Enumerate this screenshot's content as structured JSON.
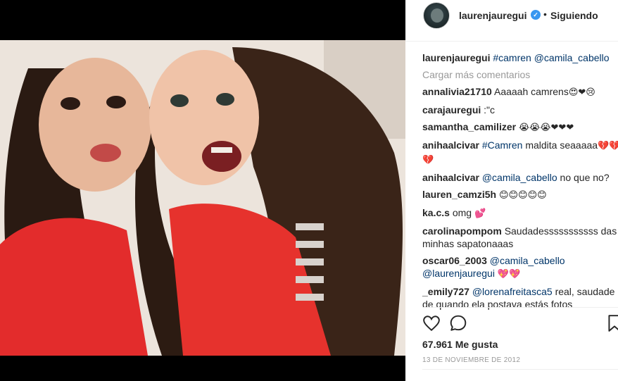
{
  "post": {
    "username": "laurenjauregui",
    "follow_label": "Siguiendo",
    "caption_user": "laurenjauregui",
    "caption_text": "#camren @camila_cabello",
    "load_more": "Cargar más comentarios",
    "likes": "67.961 Me gusta",
    "date": "13 DE NOVIEMBRE DE 2012"
  },
  "comments": [
    {
      "user": "annalivia21710",
      "text": "Aaaaah camrens",
      "emoji": "😍❤😢"
    },
    {
      "user": "carajauregui",
      "text": ":\"c",
      "emoji": ""
    },
    {
      "user": "samantha_camilizer",
      "text": "",
      "emoji": "😭😭😭❤❤❤"
    },
    {
      "user": "anihaalcivar",
      "tag": "#Camren",
      "text": "maldita seaaaaa",
      "emoji": "💔💔💔"
    },
    {
      "user": "anihaalcivar",
      "tag": "@camila_cabello",
      "text": "no que no?",
      "emoji": ""
    },
    {
      "user": "lauren_camzi5h",
      "text": "",
      "emoji": "😊😊😊😊😊"
    },
    {
      "user": "ka.c.s",
      "text": "omg",
      "emoji": "💕"
    },
    {
      "user": "carolinapompom",
      "text": "Saudadesssssssssss das minhas sapatonaaas",
      "emoji": ""
    },
    {
      "user": "oscar06_2003",
      "tag": "@camila_cabello @laurenjauregui",
      "text": "",
      "emoji": "💖💖"
    },
    {
      "user": "_emily727",
      "tag": "@lorenafreitasca5",
      "text": "real, saudade de quando ela postava estás fotos",
      "emoji": ""
    }
  ],
  "icons": [
    "heart-icon",
    "comment-icon",
    "bookmark-icon",
    "verified-icon"
  ],
  "colors": {
    "link": "#003569",
    "muted": "#999999",
    "verified": "#3897f0"
  }
}
